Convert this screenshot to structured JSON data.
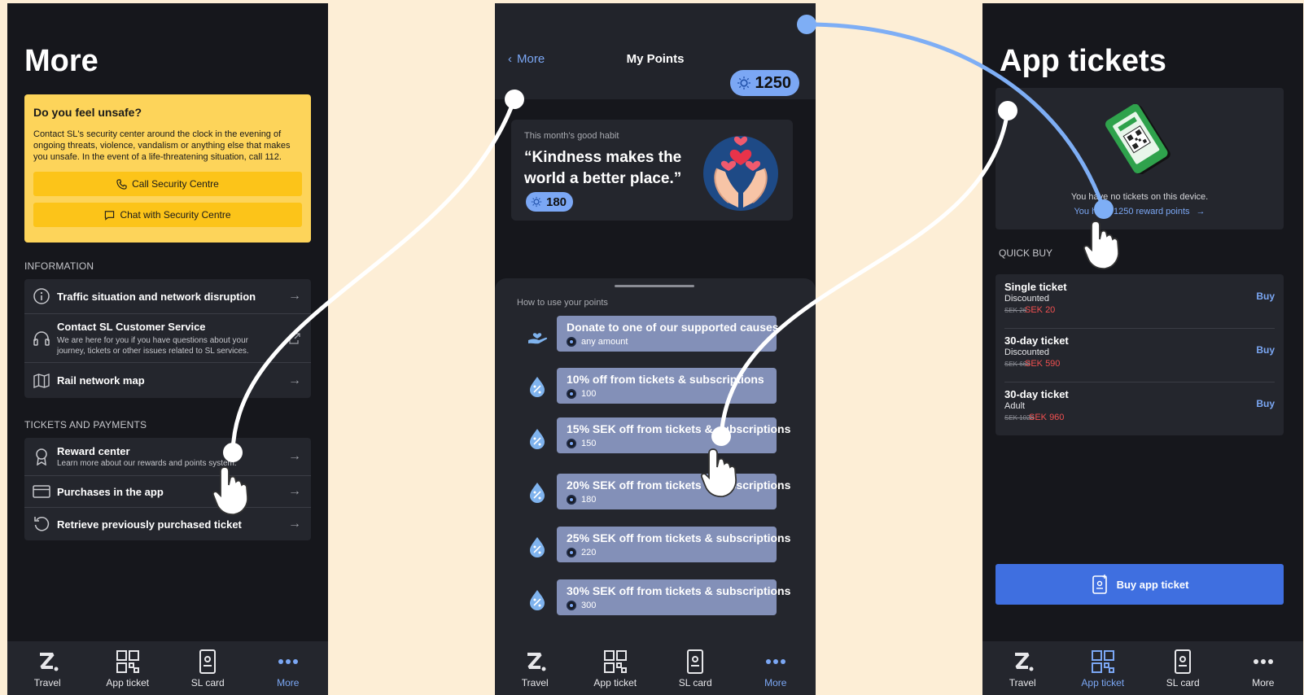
{
  "tabs": [
    {
      "label": "Travel",
      "icon": "travel-icon"
    },
    {
      "label": "App ticket",
      "icon": "app-ticket-icon"
    },
    {
      "label": "SL card",
      "icon": "sl-card-icon"
    },
    {
      "label": "More",
      "icon": "more-dots-icon"
    }
  ],
  "screen1": {
    "title": "More",
    "alert": {
      "title": "Do you feel unsafe?",
      "body": "Contact SL's security center around the clock in the evening of ongoing threats, violence, vandalism or anything else that makes you unsafe. In the event of a life-threatening situation, call 112.",
      "call_label": "Call Security Centre",
      "chat_label": "Chat with Security Centre"
    },
    "information_label": "INFORMATION",
    "information": [
      {
        "title": "Traffic situation and network disruption"
      },
      {
        "title": "Contact SL Customer Service",
        "subtitle": "We are here for you if you have questions about your journey, tickets or other issues related to SL services."
      },
      {
        "title": "Rail network map"
      }
    ],
    "tickets_label": "TICKETS AND PAYMENTS",
    "tickets": [
      {
        "title": "Reward center",
        "subtitle": "Learn more about our rewards and points system."
      },
      {
        "title": "Purchases in the app"
      },
      {
        "title": "Retrieve previously purchased ticket"
      }
    ]
  },
  "screen2": {
    "back_label": "More",
    "title": "My Points",
    "points": "1250",
    "habit_label": "This month's good habit",
    "habit_quote": "“Kindness makes the world a better place.”",
    "habit_points": "180",
    "sheet_label": "How to use your points",
    "options": [
      {
        "title": "Donate to one of our supported causes",
        "cost": "any amount",
        "icon": "donate-hand-icon"
      },
      {
        "title": "10% off from tickets & subscriptions",
        "cost": "100",
        "icon": "drop-percent-icon"
      },
      {
        "title": "15% SEK off from tickets & subscriptions",
        "cost": "150",
        "icon": "drop-percent-icon"
      },
      {
        "title": "20% SEK off from tickets & subscriptions",
        "cost": "180",
        "icon": "drop-percent-icon"
      },
      {
        "title": "25% SEK off from tickets & subscriptions",
        "cost": "220",
        "icon": "drop-percent-icon"
      },
      {
        "title": "30% SEK off from tickets & subscriptions",
        "cost": "300",
        "icon": "drop-percent-icon"
      }
    ]
  },
  "screen3": {
    "title": "App tickets",
    "empty_text": "You have no tickets on this device.",
    "reward_link": "You have 1250 reward points",
    "quick_buy_label": "QUICK BUY",
    "tickets": [
      {
        "name": "Single ticket",
        "type": "Discounted",
        "old": "SEK 26",
        "price": "SEK 20",
        "buy": "Buy"
      },
      {
        "name": "30-day ticket",
        "type": "Discounted",
        "old": "SEK 660",
        "price": "SEK 590",
        "buy": "Buy"
      },
      {
        "name": "30-day ticket",
        "type": "Adult",
        "old": "SEK 1020",
        "price": "SEK 960",
        "buy": "Buy"
      }
    ],
    "buy_button": "Buy app ticket"
  },
  "colors": {
    "accent": "#7ba7f4",
    "alert": "#fdd45a",
    "primary_button": "#3f6fe0",
    "price": "#f15050",
    "background": "#fdeed6"
  }
}
